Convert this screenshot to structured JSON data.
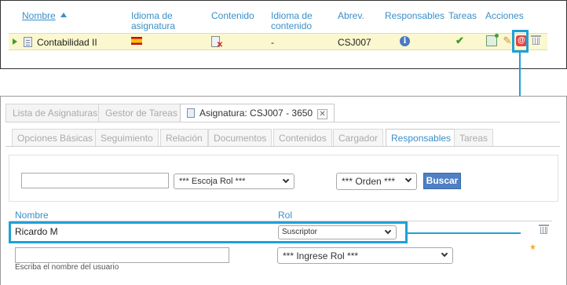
{
  "top": {
    "headers": {
      "name": "Nombre",
      "subject_language_l1": "Idioma de",
      "subject_language_l2": "asignatura",
      "content": "Contenido",
      "content_language_l1": "Idioma de",
      "content_language_l2": "contenido",
      "abbrev": "Abrev.",
      "responsible": "Responsables",
      "tasks": "Tareas",
      "actions": "Acciones"
    },
    "row": {
      "name": "Contabilidad II",
      "content_language": "-",
      "abbrev": "CSJ007"
    },
    "icons": {
      "info": "i",
      "check": "✔",
      "edit": "✎",
      "at": "@"
    }
  },
  "bottom": {
    "main_tabs": {
      "subjects_list": "Lista de Asignaturas",
      "task_manager": "Gestor de Tareas",
      "active_tab": "Asignatura: CSJ007 - 3650",
      "close": "✕"
    },
    "sub_tabs": [
      "Opciones Básicas",
      "Seguimiento",
      "Relación",
      "Documentos",
      "Contenidos",
      "Cargador",
      "Responsables",
      "Tareas"
    ],
    "filter": {
      "role_select": "*** Escoja Rol ***",
      "order_select": "*** Orden ***",
      "search_button": "Buscar"
    },
    "table": {
      "col_name": "Nombre",
      "col_role": "Rol",
      "user_name": "Ricardo M",
      "user_role": "Suscriptor",
      "new_role_select": "*** Ingrese Rol ***",
      "hint": "Escriba el nombre del usuario",
      "star": "★"
    }
  },
  "colors": {
    "accent": "#3a8fc8",
    "highlight": "#1ea0d8",
    "row_bg": "#fbf7cf",
    "button": "#4f7fc4"
  }
}
